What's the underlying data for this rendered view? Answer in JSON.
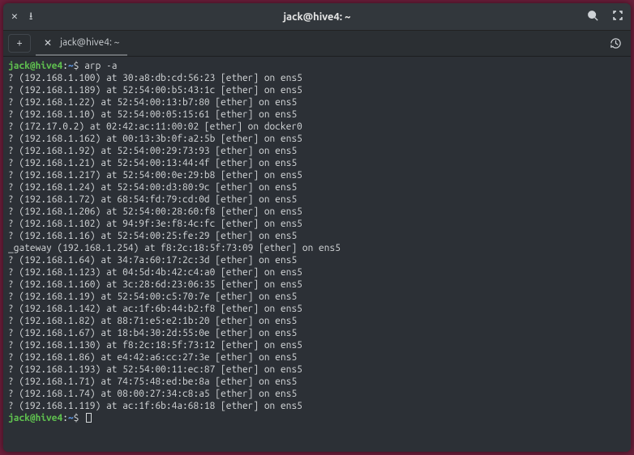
{
  "window": {
    "title": "jack@hive4: ~"
  },
  "tab": {
    "label": "jack@hive4: ~"
  },
  "prompt": {
    "user_host": "jack@hive4",
    "path": "~",
    "symbol": "$"
  },
  "command": "arp -a",
  "arp_entries": [
    {
      "host": "?",
      "ip": "192.168.1.100",
      "mac": "30:a8:db:cd:56:23",
      "type": "ether",
      "iface": "ens5"
    },
    {
      "host": "?",
      "ip": "192.168.1.189",
      "mac": "52:54:00:b5:43:1c",
      "type": "ether",
      "iface": "ens5"
    },
    {
      "host": "?",
      "ip": "192.168.1.22",
      "mac": "52:54:00:13:b7:80",
      "type": "ether",
      "iface": "ens5"
    },
    {
      "host": "?",
      "ip": "192.168.1.10",
      "mac": "52:54:00:05:15:61",
      "type": "ether",
      "iface": "ens5"
    },
    {
      "host": "?",
      "ip": "172.17.0.2",
      "mac": "02:42:ac:11:00:02",
      "type": "ether",
      "iface": "docker0"
    },
    {
      "host": "?",
      "ip": "192.168.1.162",
      "mac": "00:13:3b:0f:a2:5b",
      "type": "ether",
      "iface": "ens5"
    },
    {
      "host": "?",
      "ip": "192.168.1.92",
      "mac": "52:54:00:29:73:93",
      "type": "ether",
      "iface": "ens5"
    },
    {
      "host": "?",
      "ip": "192.168.1.21",
      "mac": "52:54:00:13:44:4f",
      "type": "ether",
      "iface": "ens5"
    },
    {
      "host": "?",
      "ip": "192.168.1.217",
      "mac": "52:54:00:0e:29:b8",
      "type": "ether",
      "iface": "ens5"
    },
    {
      "host": "?",
      "ip": "192.168.1.24",
      "mac": "52:54:00:d3:80:9c",
      "type": "ether",
      "iface": "ens5"
    },
    {
      "host": "?",
      "ip": "192.168.1.72",
      "mac": "68:54:fd:79:cd:0d",
      "type": "ether",
      "iface": "ens5"
    },
    {
      "host": "?",
      "ip": "192.168.1.206",
      "mac": "52:54:00:28:60:f8",
      "type": "ether",
      "iface": "ens5"
    },
    {
      "host": "?",
      "ip": "192.168.1.102",
      "mac": "94:9f:3e:f8:4c:fc",
      "type": "ether",
      "iface": "ens5"
    },
    {
      "host": "?",
      "ip": "192.168.1.16",
      "mac": "52:54:00:25:fe:29",
      "type": "ether",
      "iface": "ens5"
    },
    {
      "host": "_gateway",
      "ip": "192.168.1.254",
      "mac": "f8:2c:18:5f:73:09",
      "type": "ether",
      "iface": "ens5"
    },
    {
      "host": "?",
      "ip": "192.168.1.64",
      "mac": "34:7a:60:17:2c:3d",
      "type": "ether",
      "iface": "ens5"
    },
    {
      "host": "?",
      "ip": "192.168.1.123",
      "mac": "04:5d:4b:42:c4:a0",
      "type": "ether",
      "iface": "ens5"
    },
    {
      "host": "?",
      "ip": "192.168.1.160",
      "mac": "3c:28:6d:23:06:35",
      "type": "ether",
      "iface": "ens5"
    },
    {
      "host": "?",
      "ip": "192.168.1.19",
      "mac": "52:54:00:c5:70:7e",
      "type": "ether",
      "iface": "ens5"
    },
    {
      "host": "?",
      "ip": "192.168.1.142",
      "mac": "ac:1f:6b:44:b2:f8",
      "type": "ether",
      "iface": "ens5"
    },
    {
      "host": "?",
      "ip": "192.168.1.82",
      "mac": "88:71:e5:e2:1b:20",
      "type": "ether",
      "iface": "ens5"
    },
    {
      "host": "?",
      "ip": "192.168.1.67",
      "mac": "18:b4:30:2d:55:0e",
      "type": "ether",
      "iface": "ens5"
    },
    {
      "host": "?",
      "ip": "192.168.1.130",
      "mac": "f8:2c:18:5f:73:12",
      "type": "ether",
      "iface": "ens5"
    },
    {
      "host": "?",
      "ip": "192.168.1.86",
      "mac": "e4:42:a6:cc:27:3e",
      "type": "ether",
      "iface": "ens5"
    },
    {
      "host": "?",
      "ip": "192.168.1.193",
      "mac": "52:54:00:11:ec:87",
      "type": "ether",
      "iface": "ens5"
    },
    {
      "host": "?",
      "ip": "192.168.1.71",
      "mac": "74:75:48:ed:be:8a",
      "type": "ether",
      "iface": "ens5"
    },
    {
      "host": "?",
      "ip": "192.168.1.74",
      "mac": "08:00:27:34:c8:a5",
      "type": "ether",
      "iface": "ens5"
    },
    {
      "host": "?",
      "ip": "192.168.1.119",
      "mac": "ac:1f:6b:4a:68:18",
      "type": "ether",
      "iface": "ens5"
    }
  ]
}
